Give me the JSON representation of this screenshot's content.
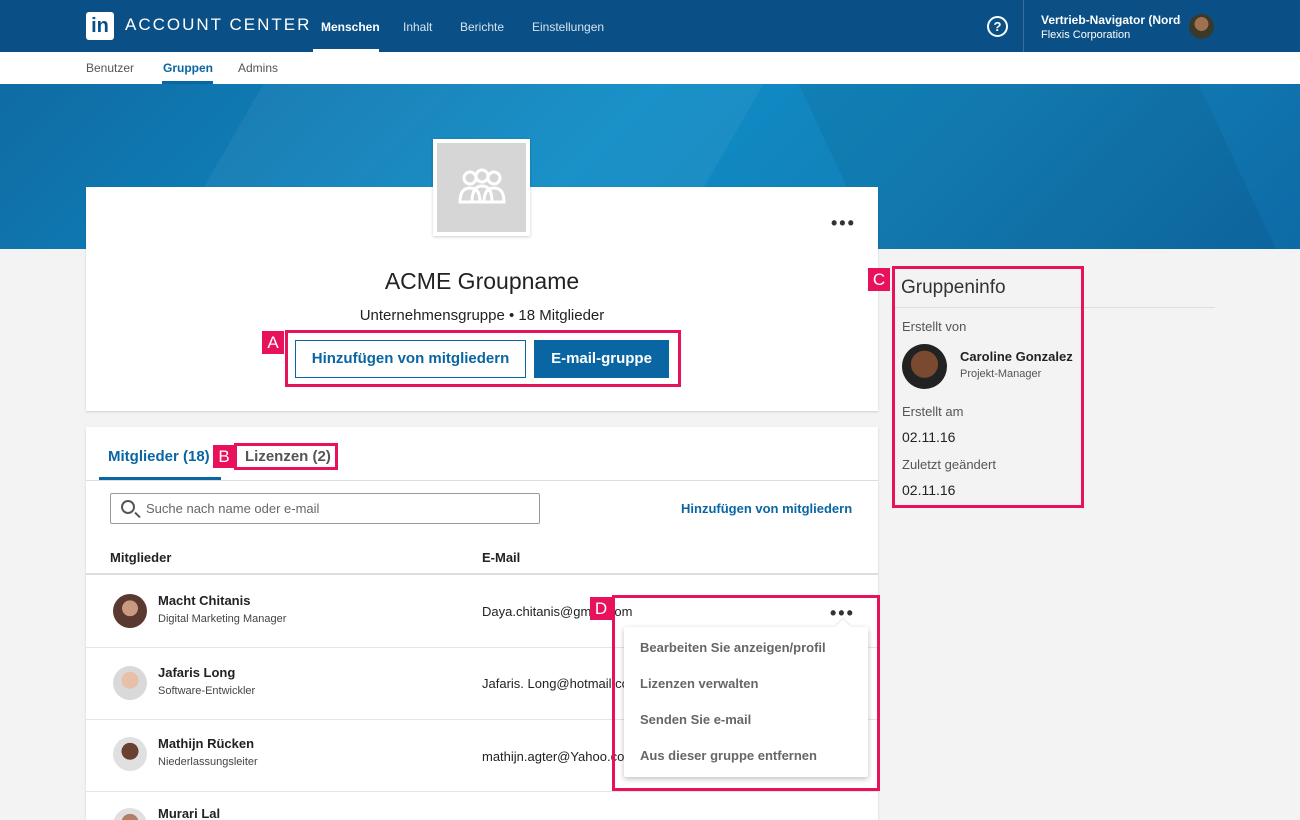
{
  "topnav": {
    "logo": "in",
    "brand": "ACCOUNT CENTER",
    "items": [
      "Menschen",
      "Inhalt",
      "Berichte",
      "Einstellungen"
    ],
    "help": "?",
    "account_name": "Vertrieb-Navigator (Nordamerika)",
    "account_org": "Flexis Corporation"
  },
  "subnav": {
    "items": [
      "Benutzer",
      "Gruppen",
      "Admins"
    ]
  },
  "group": {
    "name": "ACME Groupname",
    "subtitle": "Unternehmensgruppe • 18 Mitglieder",
    "add_button": "Hinzufügen von mitgliedern",
    "email_button": "E-mail-gruppe",
    "more": "•••"
  },
  "annotations": {
    "a": "A",
    "b": "B",
    "c": "C",
    "d": "D"
  },
  "tabs": [
    "Mitglieder (18)",
    "Lizenzen (2)"
  ],
  "search": {
    "placeholder": "Suche nach name oder e-mail"
  },
  "add_members_link": "Hinzufügen von mitgliedern",
  "columns": [
    "Mitglieder",
    "E-Mail"
  ],
  "members": [
    {
      "name": "Macht Chitanis",
      "title": "Digital Marketing Manager",
      "email": "Daya.chitanis@gmail.com"
    },
    {
      "name": "Jafaris Long",
      "title": "Software-Entwickler",
      "email": "Jafaris. Long@hotmail.com"
    },
    {
      "name": "Mathijn Rücken",
      "title": "Niederlassungsleiter",
      "email": "mathijn.agter@Yahoo.com"
    },
    {
      "name": "Murari Lal",
      "title": "",
      "email": ""
    }
  ],
  "row_menu": {
    "dots": "•••",
    "items": [
      "Bearbeiten Sie anzeigen/profil",
      "Lizenzen verwalten",
      "Senden Sie e-mail",
      "Aus dieser gruppe entfernen"
    ]
  },
  "info": {
    "title": "Gruppeninfo",
    "created_by_label": "Erstellt von",
    "creator_name": "Caroline Gonzalez",
    "creator_role": "Projekt-Manager",
    "created_on_label": "Erstellt am",
    "created_on": "02.11.16",
    "modified_label": "Zuletzt geändert",
    "modified_on": "02.11.16"
  },
  "colors": {
    "nav": "#0a4f85",
    "accent": "#0a66a2",
    "annotation": "#e8115b"
  }
}
